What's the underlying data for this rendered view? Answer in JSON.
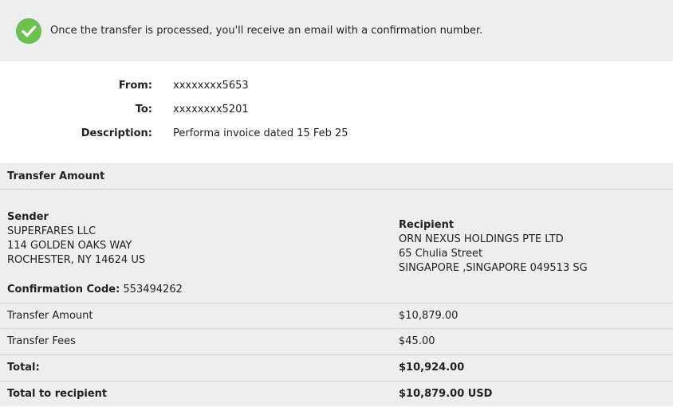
{
  "banner": {
    "message": "Once the transfer is processed, you'll receive an email with a confirmation number.",
    "icon": "check-circle-icon",
    "icon_color": "#5cb85c"
  },
  "details": {
    "from_label": "From:",
    "from_value": "xxxxxxxx5653",
    "to_label": "To:",
    "to_value": "xxxxxxxx5201",
    "description_label": "Description:",
    "description_value": "Performa invoice dated 15 Feb 25"
  },
  "transfer": {
    "section_title": "Transfer Amount",
    "sender": {
      "title": "Sender",
      "name": "SUPERFARES LLC",
      "address1": "114 GOLDEN OAKS WAY",
      "address2": "ROCHESTER, NY 14624 US"
    },
    "recipient": {
      "title": "Recipient",
      "name": "ORN NEXUS HOLDINGS PTE LTD",
      "address1": "65 Chulia Street",
      "address2": "SINGAPORE ,SINGAPORE 049513 SG"
    },
    "confirmation_label": "Confirmation Code:",
    "confirmation_value": "553494262",
    "rows": [
      {
        "label": "Transfer Amount",
        "value": "$10,879.00"
      },
      {
        "label": "Transfer Fees",
        "value": "$45.00"
      },
      {
        "label": "Total:",
        "value": "$10,924.00"
      },
      {
        "label": "Total to recipient",
        "value": "$10,879.00 USD"
      }
    ]
  },
  "colors": {
    "banner_bg": "#eeeeee",
    "panel_bg": "#eeeeee",
    "divider": "#d6d6d6",
    "text": "#222222"
  }
}
